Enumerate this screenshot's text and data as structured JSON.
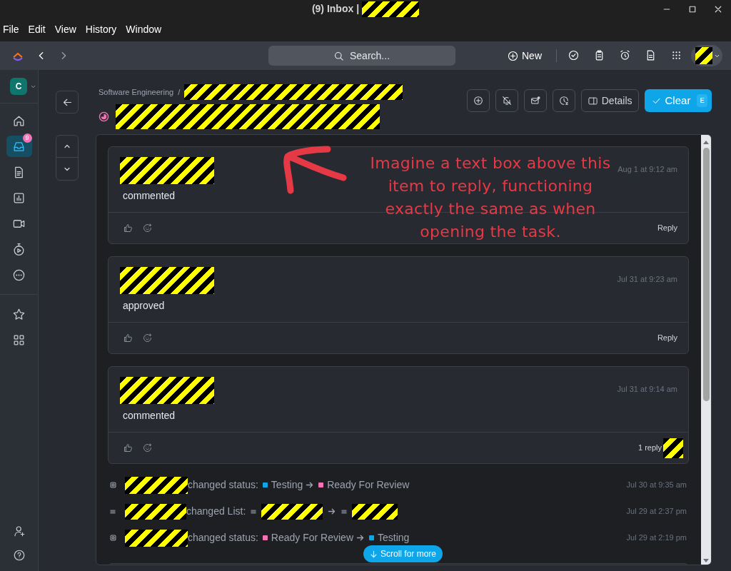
{
  "window": {
    "title": "(9) Inbox |"
  },
  "menu": [
    "File",
    "Edit",
    "View",
    "History",
    "Window"
  ],
  "toolbar": {
    "search": {
      "placeholder": "Search..."
    },
    "new_button": "New"
  },
  "sidebar": {
    "workspace": "C",
    "items": [
      {
        "kind": "home",
        "selected": false
      },
      {
        "kind": "inbox",
        "selected": true,
        "badge": "9"
      },
      {
        "kind": "doc",
        "selected": false
      },
      {
        "kind": "dashboard",
        "selected": false
      },
      {
        "kind": "video",
        "selected": false
      },
      {
        "kind": "timer",
        "selected": false
      },
      {
        "kind": "more",
        "selected": false
      },
      {
        "kind": "divider"
      },
      {
        "kind": "star",
        "selected": false
      },
      {
        "kind": "apps",
        "selected": false
      }
    ],
    "bottom_items": [
      {
        "kind": "invite"
      },
      {
        "kind": "help"
      }
    ]
  },
  "header": {
    "breadcrumb": "Software Engineering",
    "separator": "/",
    "details_button": "Details",
    "clear_button": "Clear",
    "clear_shortcut": "E"
  },
  "comments": [
    {
      "action": "commented",
      "time": "Aug 1 at 9:12 am",
      "footer": {
        "kind": "reply",
        "label": "Reply"
      }
    },
    {
      "action": "approved",
      "time": "Jul 31 at 9:23 am",
      "footer": {
        "kind": "reply",
        "label": "Reply"
      }
    },
    {
      "action": "commented",
      "time": "Jul 31 at 9:14 am",
      "footer": {
        "kind": "replies",
        "label": "1 reply"
      }
    }
  ],
  "activity": [
    {
      "kind": "status",
      "action": "changed status:",
      "from": {
        "label": "Testing",
        "color": "#0ea5e9"
      },
      "to": {
        "label": "Ready For Review",
        "color": "#f472b6"
      },
      "time": "Jul 30 at 9:35 am"
    },
    {
      "kind": "list",
      "action": "changed List:",
      "time": "Jul 29 at 2:37 pm"
    },
    {
      "kind": "status",
      "action": "changed status:",
      "from": {
        "label": "Ready For Review",
        "color": "#f472b6"
      },
      "to": {
        "label": "Testing",
        "color": "#0ea5e9"
      },
      "time": "Jul 29 at 2:19 pm"
    }
  ],
  "scroll_button": "Scroll for more",
  "annotation": "Imagine a text box above this item to reply, functioning exactly the same as when opening the task."
}
